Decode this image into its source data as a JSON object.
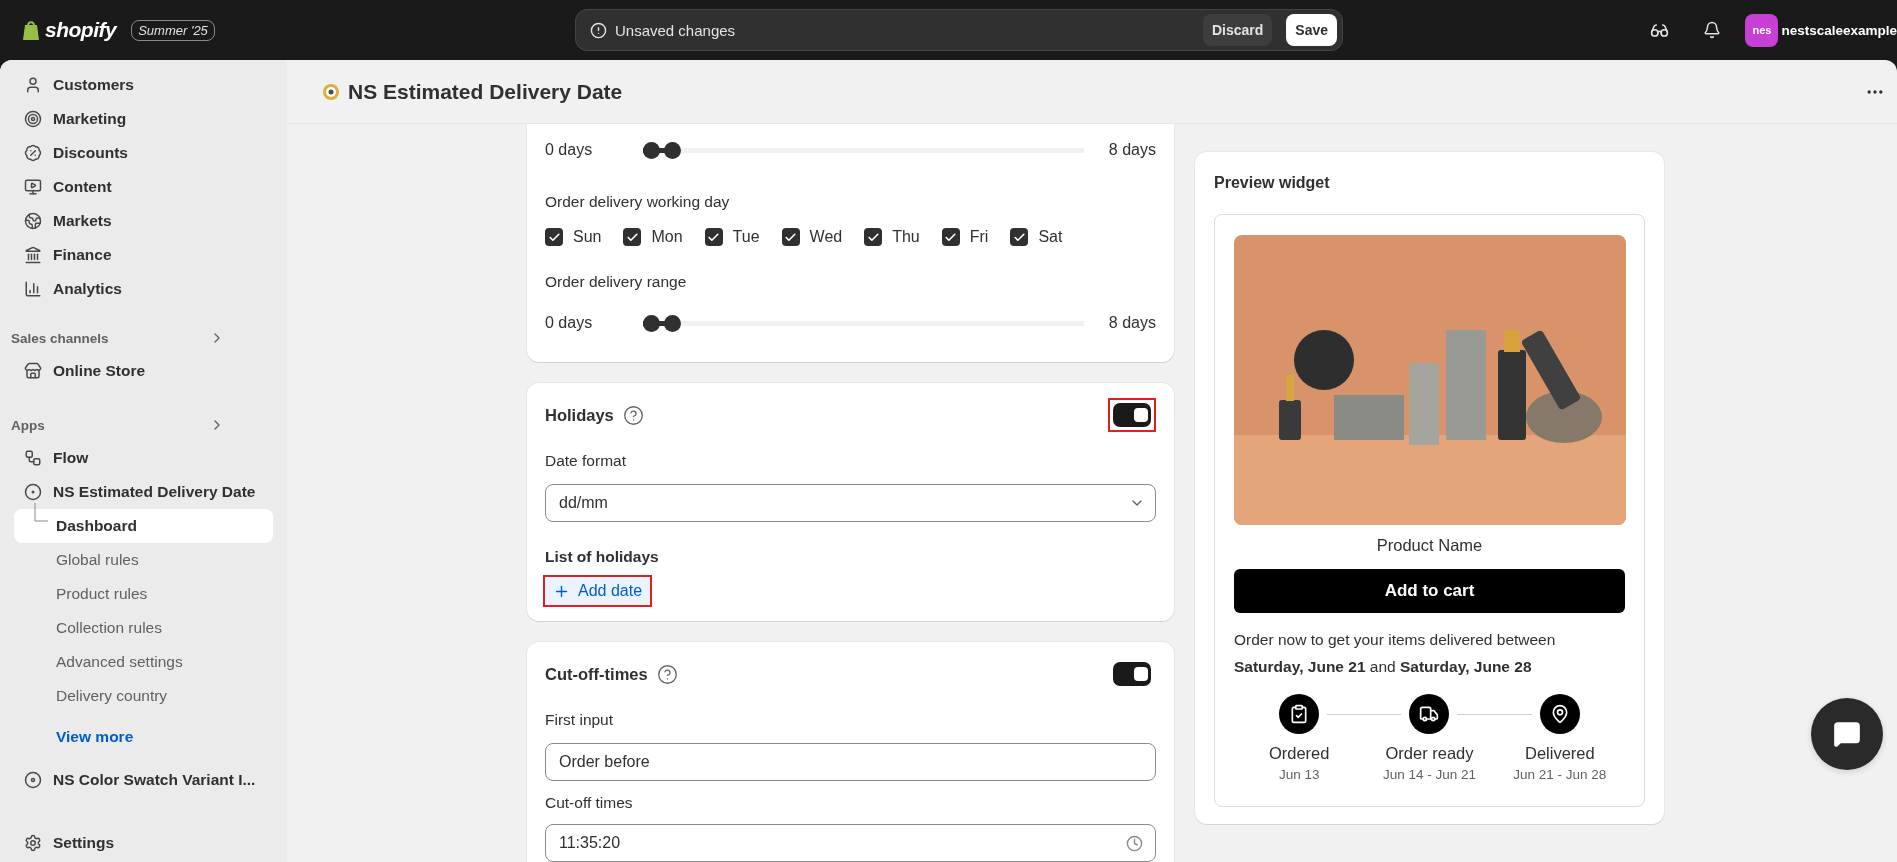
{
  "topbar": {
    "logo": "shopify",
    "edition": "Summer '25",
    "notice": "Unsaved changes",
    "buttons": [
      {
        "label": "Discard",
        "kind": "secondary"
      },
      {
        "label": "Save",
        "kind": "primary"
      }
    ],
    "user": {
      "initials": "nes",
      "name": "nestscaleexample"
    }
  },
  "sidebar": {
    "sections": [
      {
        "items": [
          {
            "label": "Customers"
          },
          {
            "label": "Marketing"
          },
          {
            "label": "Discounts"
          },
          {
            "label": "Content"
          },
          {
            "label": "Markets"
          },
          {
            "label": "Finance"
          },
          {
            "label": "Analytics"
          }
        ]
      },
      {
        "title": "Sales channels",
        "items": [
          {
            "label": "Online Store"
          }
        ]
      },
      {
        "title": "Apps",
        "items": [
          {
            "label": "Flow"
          },
          {
            "label": "NS Estimated Delivery Date",
            "children": [
              {
                "label": "Dashboard",
                "selected": true
              },
              {
                "label": "Global rules",
                "selected": false
              },
              {
                "label": "Product rules",
                "selected": false
              },
              {
                "label": "Collection rules",
                "selected": false
              },
              {
                "label": "Advanced settings",
                "selected": false
              },
              {
                "label": "Delivery country",
                "selected": false
              }
            ]
          },
          {
            "label": "View more",
            "kind": "link"
          },
          {
            "label": "NS Color Swatch Variant I..."
          }
        ]
      }
    ],
    "footer": {
      "label": "Settings"
    }
  },
  "page": {
    "title": "NS Estimated Delivery Date"
  },
  "cards": [
    {
      "kind": "settings",
      "fields": [
        {
          "kind": "range",
          "min_label": "0 days",
          "max_label": "8 days",
          "level": 0.05
        },
        {
          "kind": "label",
          "text": "Order delivery working day"
        },
        {
          "kind": "days",
          "days": [
            {
              "label": "Sun",
              "checked": true
            },
            {
              "label": "Mon",
              "checked": true
            },
            {
              "label": "Tue",
              "checked": true
            },
            {
              "label": "Wed",
              "checked": true
            },
            {
              "label": "Thu",
              "checked": true
            },
            {
              "label": "Fri",
              "checked": true
            },
            {
              "label": "Sat",
              "checked": true
            }
          ]
        },
        {
          "kind": "label",
          "text": "Order delivery range"
        },
        {
          "kind": "range",
          "min_label": "0 days",
          "max_label": "8 days",
          "level": 0.05
        }
      ]
    },
    {
      "kind": "section",
      "title": "Holidays",
      "toggle_on": true,
      "toggle_highlighted": true,
      "fields": [
        {
          "kind": "label",
          "text": "Date format"
        },
        {
          "kind": "select",
          "value": "dd/mm"
        },
        {
          "kind": "heading",
          "text": "List of holidays"
        },
        {
          "kind": "add",
          "label": "Add date",
          "highlighted": true
        }
      ]
    },
    {
      "kind": "section",
      "title": "Cut-off-times",
      "toggle_on": true,
      "toggle_highlighted": false,
      "fields": [
        {
          "kind": "label",
          "text": "First input"
        },
        {
          "kind": "input",
          "value": "Order before"
        },
        {
          "kind": "label",
          "text": "Cut-off times"
        },
        {
          "kind": "time",
          "value": "11:35:20"
        }
      ]
    }
  ],
  "preview": {
    "title": "Preview widget",
    "product_name": "Product Name",
    "button": "Add to cart",
    "message": "Order now to get your items delivered between **Saturday, June 21** and **Saturday, June 28**",
    "steps": [
      {
        "label": "Ordered",
        "date": "Jun 13"
      },
      {
        "label": "Order ready",
        "date": "Jun 14 - Jun 21"
      },
      {
        "label": "Delivered",
        "date": "Jun 21 - Jun 28"
      }
    ]
  }
}
